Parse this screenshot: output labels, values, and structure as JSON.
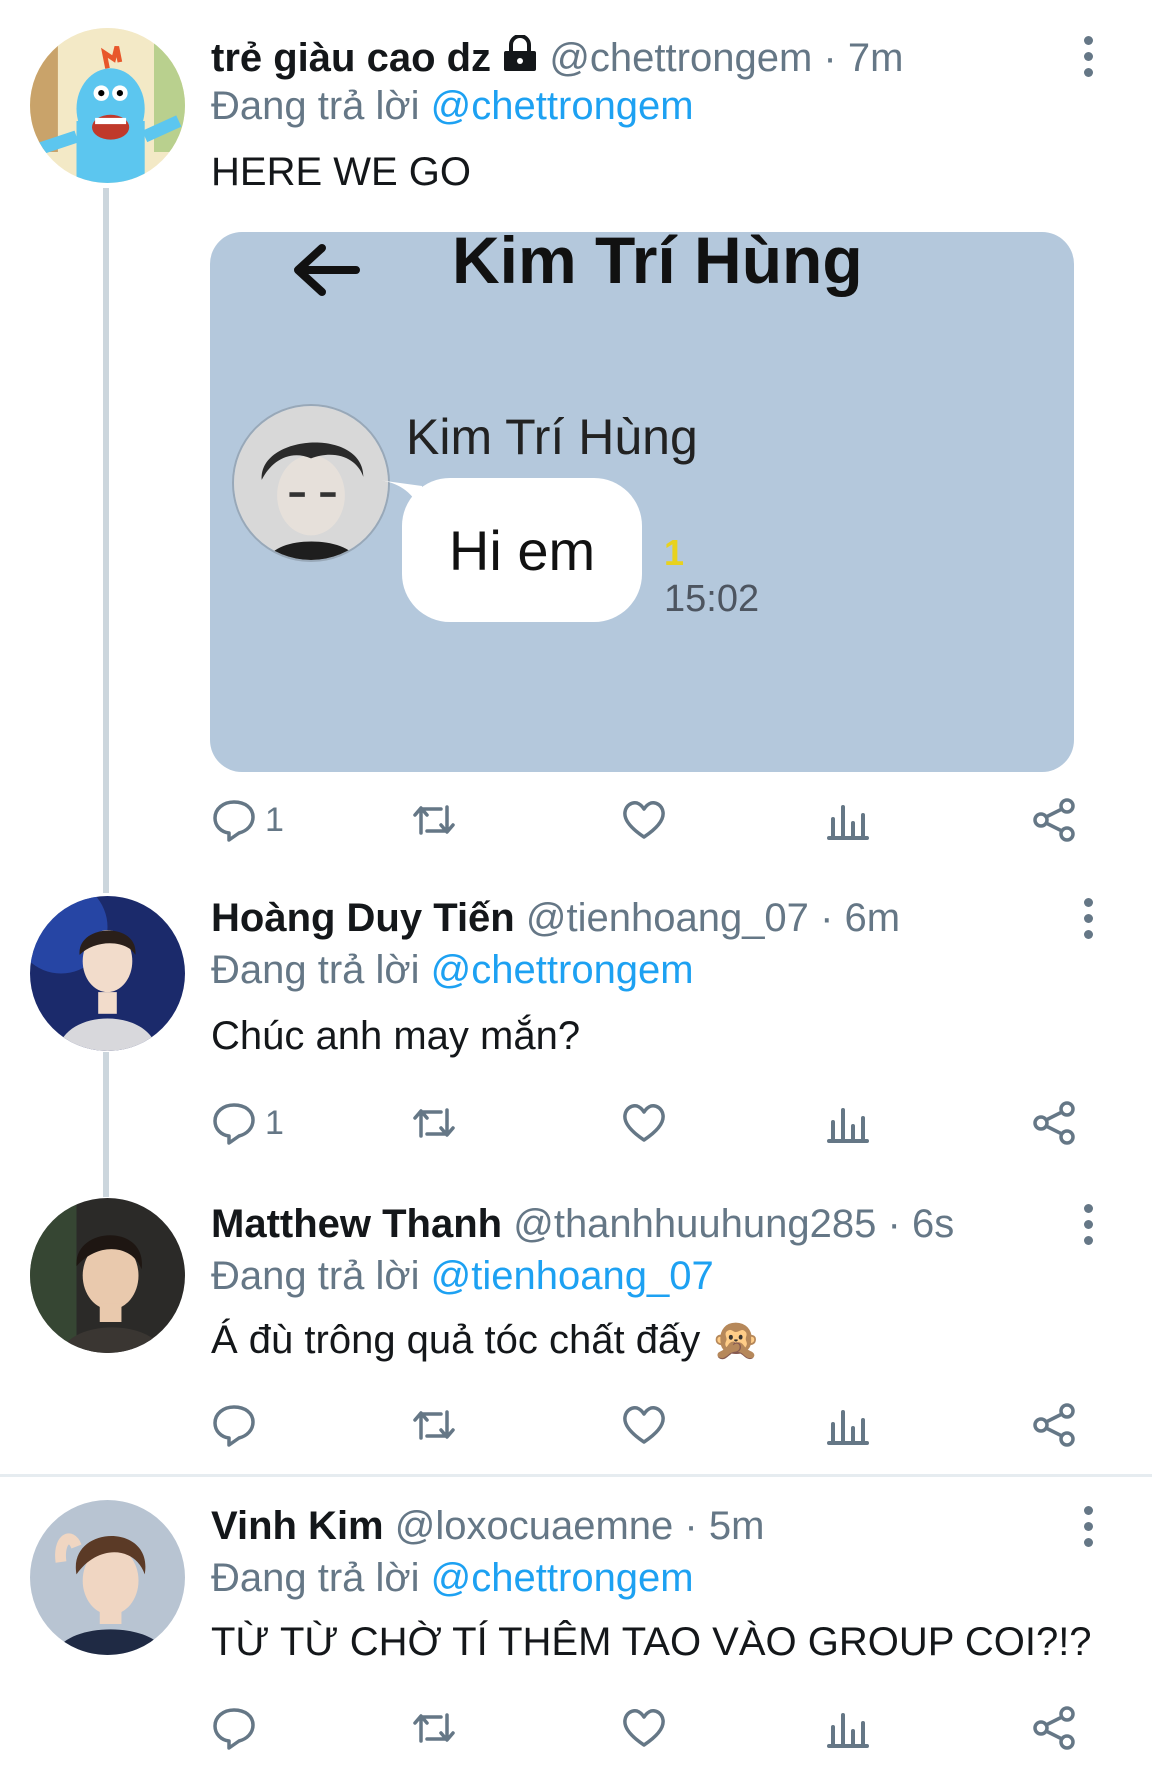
{
  "tweets": [
    {
      "name": "trẻ giàu cao dz",
      "handle": "@chettrongem",
      "time": "· 7m",
      "reply_prefix": "Đang trả lời",
      "reply_to": "@chettrongem",
      "text": "HERE WE GO",
      "reply_count": "1",
      "locked": true,
      "media": {
        "chat_title": "Kim Trí Hùng",
        "sender_name": "Kim Trí Hùng",
        "message": "Hi em",
        "unread": "1",
        "time": "15:02"
      }
    },
    {
      "name": "Hoàng Duy Tiến",
      "handle": "@tienhoang_07",
      "time": "· 6m",
      "reply_prefix": "Đang trả lời",
      "reply_to": "@chettrongem",
      "text": "Chúc anh may mắn?",
      "reply_count": "1"
    },
    {
      "name": "Matthew Thanh",
      "handle": "@thanhhuuhung285",
      "time": "· 6s",
      "reply_prefix": "Đang trả lời",
      "reply_to": "@tienhoang_07",
      "text": "Á đù trông quả tóc chất đấy",
      "emoji": "🙊",
      "reply_count": ""
    },
    {
      "name": "Vinh Kim",
      "handle": "@loxocuaemne",
      "time": "· 5m",
      "reply_prefix": "Đang trả lời",
      "reply_to": "@chettrongem",
      "text": "TỪ TỪ CHỜ TÍ THÊM TAO VÀO GROUP COI?!?",
      "reply_count": ""
    }
  ],
  "colors": {
    "accent": "#1da1f2",
    "secondary_text": "#657786",
    "media_background": "#b4c8dc"
  },
  "icons": [
    "reply-icon",
    "retweet-icon",
    "like-icon",
    "analytics-icon",
    "share-icon",
    "more-icon",
    "lock-icon",
    "back-arrow-icon"
  ]
}
